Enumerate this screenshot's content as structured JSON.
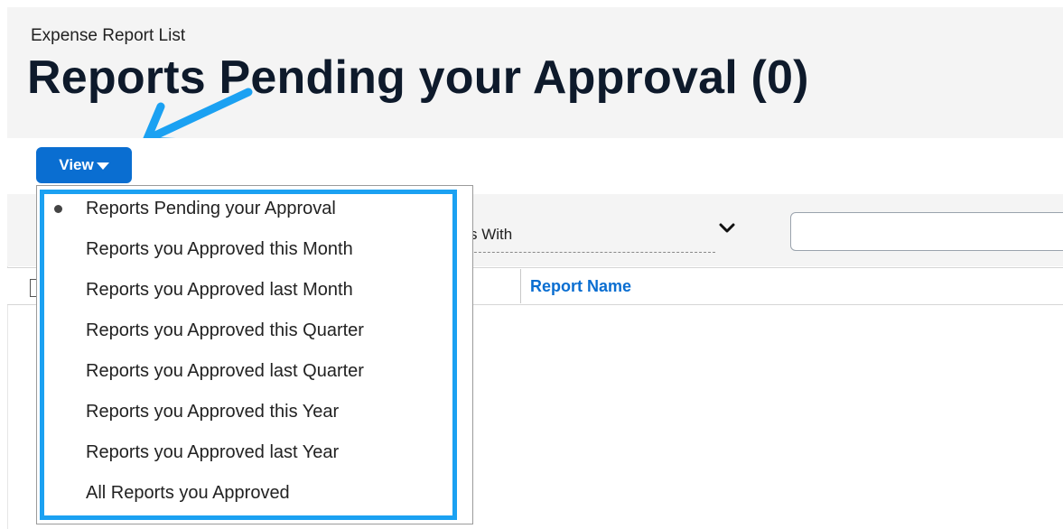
{
  "breadcrumb": "Expense Report List",
  "page_title": "Reports Pending your Approval (0)",
  "view_button": {
    "label": "View"
  },
  "filter": {
    "search_by_value": "s With"
  },
  "table": {
    "columns": [
      "Report Name"
    ]
  },
  "view_menu": {
    "items": [
      {
        "label": "Reports Pending your Approval",
        "selected": true
      },
      {
        "label": "Reports you Approved this Month",
        "selected": false
      },
      {
        "label": "Reports you Approved last Month",
        "selected": false
      },
      {
        "label": "Reports you Approved this Quarter",
        "selected": false
      },
      {
        "label": "Reports you Approved last Quarter",
        "selected": false
      },
      {
        "label": "Reports you Approved this Year",
        "selected": false
      },
      {
        "label": "Reports you Approved last Year",
        "selected": false
      },
      {
        "label": "All Reports you Approved",
        "selected": false
      }
    ]
  },
  "colors": {
    "accent": "#0a6ed1",
    "highlight": "#1ba1f2",
    "title": "#0e1a2b"
  },
  "icons": {
    "view_caret": "caret-down-icon",
    "select_chevron": "chevron-down-icon",
    "annotation": "arrow-icon"
  }
}
